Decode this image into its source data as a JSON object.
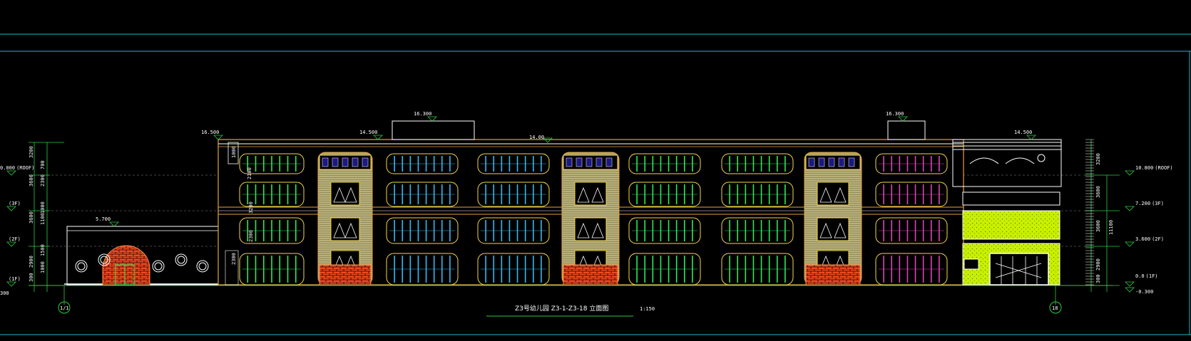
{
  "title": {
    "text": "Z3号幼儿园  Z3-1-Z3-18 立面图",
    "scale": "1:150"
  },
  "elevations_left": [
    "0.000",
    "(ROOF)",
    "(3F)",
    "(2F)",
    "(1F)",
    "300"
  ],
  "dims_left": [
    "3200",
    "3600",
    "3600",
    "1100",
    "2900",
    "2300",
    "700",
    "1000",
    "1500",
    "1000",
    "300"
  ],
  "elevations_top": [
    "16.500",
    "16.300",
    "14.500",
    "14.00",
    "16.300",
    "14.500",
    "5.700"
  ],
  "elevations_right": [
    "10.800",
    "(ROOF)",
    "7.200",
    "(3F)",
    "3.600",
    "(2F)",
    "0.0",
    "(1F)",
    "-0.300"
  ],
  "dims_right": [
    "3200",
    "3600",
    "3600",
    "2900",
    "300",
    "11100"
  ],
  "dims_mid": [
    "1000",
    "2100",
    "3200",
    "2300",
    "2300"
  ],
  "axis_labels": [
    "1/1",
    "18"
  ],
  "colors": {
    "background": "#000000",
    "frame_cyan": "#1fb7c9",
    "outline": "#ffffff",
    "facade_orange": "#e8a13a",
    "window_green": "#2ee85a",
    "window_cyan": "#35b9f0",
    "window_magenta": "#e040b8",
    "window_frame_yellow": "#f5d84a",
    "brick_red": "#f04a1e",
    "stair_tower": "#b8b07a",
    "annex_lime": "#c8f000",
    "level_marker": "#2ecc40"
  }
}
